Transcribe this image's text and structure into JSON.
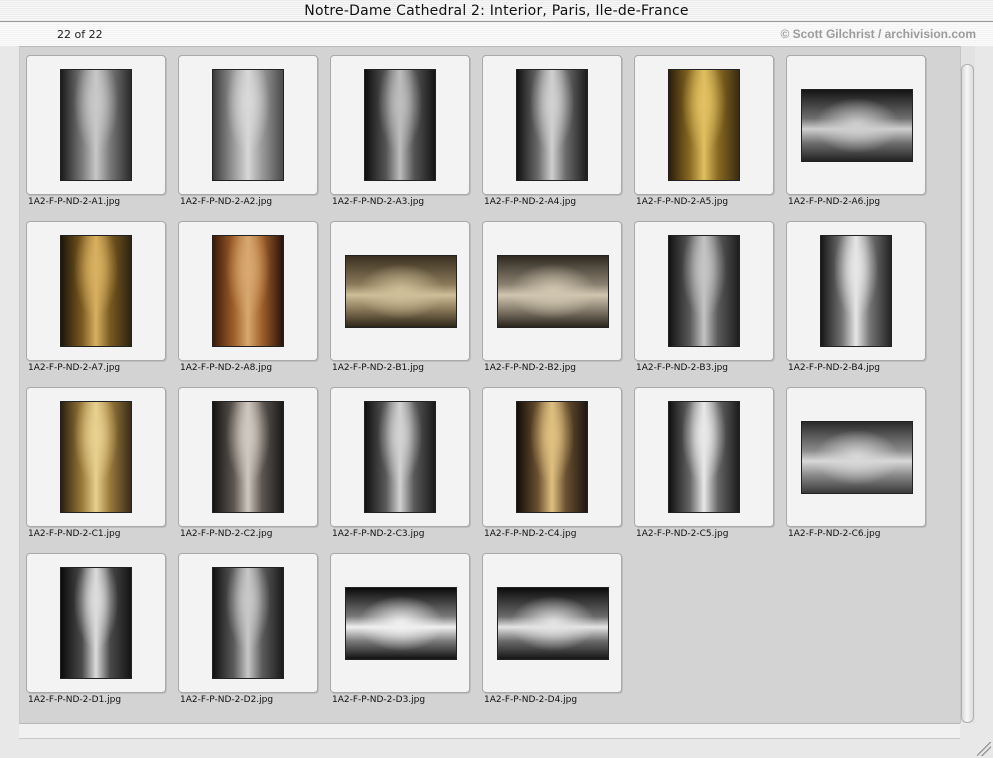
{
  "window": {
    "title": "Notre-Dame Cathedral 2: Interior, Paris, Ile-de-France"
  },
  "header": {
    "count": "22 of 22",
    "copyright": "© Scott Gilchrist / archivision.com"
  },
  "images": [
    {
      "filename": "1A2-F-P-ND-2-A1.jpg",
      "orientation": "portrait",
      "colors": [
        "#1a1a1a",
        "#7a7a7a",
        "#c8c8c8",
        "#2a2a2a"
      ]
    },
    {
      "filename": "1A2-F-P-ND-2-A2.jpg",
      "orientation": "portrait",
      "colors": [
        "#3a3a3a",
        "#9a9a9a",
        "#d8d8d8",
        "#4a4a4a"
      ]
    },
    {
      "filename": "1A2-F-P-ND-2-A3.jpg",
      "orientation": "portrait",
      "colors": [
        "#0e0e0e",
        "#555555",
        "#bdbdbd",
        "#151515"
      ]
    },
    {
      "filename": "1A2-F-P-ND-2-A4.jpg",
      "orientation": "portrait",
      "colors": [
        "#111111",
        "#6a6a6a",
        "#d0d0d0",
        "#1c1c1c"
      ]
    },
    {
      "filename": "1A2-F-P-ND-2-A5.jpg",
      "orientation": "portrait",
      "colors": [
        "#2a1e0c",
        "#8a6a22",
        "#e0c060",
        "#3a2a10"
      ]
    },
    {
      "filename": "1A2-F-P-ND-2-A6.jpg",
      "orientation": "landscape",
      "colors": [
        "#141414",
        "#6e6e6e",
        "#cfcfcf",
        "#222222"
      ]
    },
    {
      "filename": "1A2-F-P-ND-2-A7.jpg",
      "orientation": "portrait",
      "colors": [
        "#1c150a",
        "#7a5a20",
        "#d8b060",
        "#2e2412"
      ]
    },
    {
      "filename": "1A2-F-P-ND-2-A8.jpg",
      "orientation": "portrait",
      "colors": [
        "#3a1a0a",
        "#a0602a",
        "#d8a870",
        "#2a120a"
      ]
    },
    {
      "filename": "1A2-F-P-ND-2-B1.jpg",
      "orientation": "landscape",
      "colors": [
        "#3a3020",
        "#8a7a5a",
        "#cdbf98",
        "#2e2618"
      ]
    },
    {
      "filename": "1A2-F-P-ND-2-B2.jpg",
      "orientation": "landscape",
      "colors": [
        "#302a22",
        "#8a8070",
        "#d0c6b0",
        "#2a241c"
      ]
    },
    {
      "filename": "1A2-F-P-ND-2-B3.jpg",
      "orientation": "portrait",
      "colors": [
        "#121212",
        "#5a5a5a",
        "#c4c4c4",
        "#1e1e1e"
      ]
    },
    {
      "filename": "1A2-F-P-ND-2-B4.jpg",
      "orientation": "portrait",
      "colors": [
        "#161616",
        "#747474",
        "#e6e6e6",
        "#242424"
      ]
    },
    {
      "filename": "1A2-F-P-ND-2-C1.jpg",
      "orientation": "portrait",
      "colors": [
        "#2a2010",
        "#9a7a3a",
        "#e8d090",
        "#3a2c18"
      ]
    },
    {
      "filename": "1A2-F-P-ND-2-C2.jpg",
      "orientation": "portrait",
      "colors": [
        "#141414",
        "#5e5650",
        "#cfc8c0",
        "#1a1a1a"
      ]
    },
    {
      "filename": "1A2-F-P-ND-2-C3.jpg",
      "orientation": "portrait",
      "colors": [
        "#101010",
        "#5a5a5a",
        "#d2d2d2",
        "#1a1a1a"
      ]
    },
    {
      "filename": "1A2-F-P-ND-2-C4.jpg",
      "orientation": "portrait",
      "colors": [
        "#140e08",
        "#6a5030",
        "#e0c080",
        "#1e1610"
      ]
    },
    {
      "filename": "1A2-F-P-ND-2-C5.jpg",
      "orientation": "portrait",
      "colors": [
        "#101010",
        "#666666",
        "#e8e8e8",
        "#1c1c1c"
      ]
    },
    {
      "filename": "1A2-F-P-ND-2-C6.jpg",
      "orientation": "landscape",
      "colors": [
        "#2a2a2a",
        "#8a8a8a",
        "#d8d8d8",
        "#3a3a3a"
      ]
    },
    {
      "filename": "1A2-F-P-ND-2-D1.jpg",
      "orientation": "portrait",
      "colors": [
        "#0c0c0c",
        "#4a4a4a",
        "#dcdcdc",
        "#141414"
      ]
    },
    {
      "filename": "1A2-F-P-ND-2-D2.jpg",
      "orientation": "portrait",
      "colors": [
        "#101010",
        "#5c5c5c",
        "#c8c8c8",
        "#1a1a1a"
      ]
    },
    {
      "filename": "1A2-F-P-ND-2-D3.jpg",
      "orientation": "landscape",
      "colors": [
        "#0a0a0a",
        "#7a7a7a",
        "#f0f0f0",
        "#121212"
      ]
    },
    {
      "filename": "1A2-F-P-ND-2-D4.jpg",
      "orientation": "landscape",
      "colors": [
        "#0c0c0c",
        "#6a6a6a",
        "#e4e4e4",
        "#161616"
      ]
    }
  ]
}
